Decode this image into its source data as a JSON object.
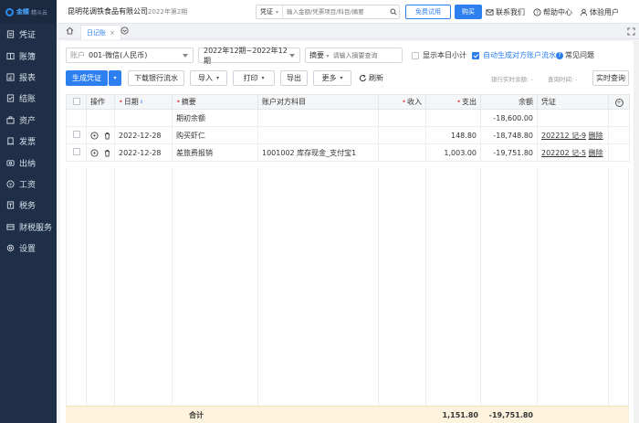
{
  "app": {
    "logo_brand": "金蝶",
    "logo_sub": "精斗云",
    "company": "昆明花调铁食品有限公司",
    "period": "2022年第2期"
  },
  "sidebar": {
    "items": [
      {
        "label": "凭证",
        "icon": "voucher-icon"
      },
      {
        "label": "账簿",
        "icon": "ledger-icon"
      },
      {
        "label": "报表",
        "icon": "report-icon"
      },
      {
        "label": "结账",
        "icon": "closing-icon"
      },
      {
        "label": "资产",
        "icon": "asset-icon"
      },
      {
        "label": "发票",
        "icon": "invoice-icon"
      },
      {
        "label": "出纳",
        "icon": "cashier-icon"
      },
      {
        "label": "工资",
        "icon": "salary-icon"
      },
      {
        "label": "税务",
        "icon": "tax-icon"
      },
      {
        "label": "财税服务",
        "icon": "service-icon"
      },
      {
        "label": "设置",
        "icon": "settings-icon"
      }
    ]
  },
  "topbar": {
    "search_type": "凭证",
    "search_placeholder": "输入金额/凭票项目/科目/摘要",
    "free_trial": "免费试用",
    "buy": "购买",
    "contact": "联系我们",
    "help": "帮助中心",
    "user": "体验用户"
  },
  "tabs": {
    "active": "日记账"
  },
  "filters": {
    "account_label": "账户",
    "account_value": "001-微信(人民币)",
    "period_value": "2022年12期~2022年12期",
    "summary_label": "摘要",
    "summary_placeholder": "请输入摘要查询",
    "show_subtotal": "显示本日小计",
    "auto_generate": "自动生成对方账户流水",
    "faq": "常见问题"
  },
  "toolbar": {
    "generate_voucher": "生成凭证",
    "download_bank": "下载银行流水",
    "import": "导入",
    "print": "打印",
    "export": "导出",
    "more": "更多",
    "refresh": "刷新",
    "bank_balance_label": "银行实时余额:",
    "bank_balance_value": "-",
    "query_time_label": "查询时间:",
    "query_time_value": "-",
    "realtime_query": "实时查询"
  },
  "table": {
    "headers": {
      "op": "操作",
      "date": "日期",
      "summary": "摘要",
      "counter_account": "账户对方科目",
      "income": "收入",
      "expense": "支出",
      "balance": "余额",
      "voucher": "凭证"
    },
    "rows": [
      {
        "date": "",
        "summary": "期初余额",
        "counter": "",
        "income": "",
        "expense": "",
        "balance": "-18,600.00",
        "voucher": "",
        "delete": ""
      },
      {
        "date": "2022-12-28",
        "summary": "购买虾仁",
        "counter": "",
        "income": "",
        "expense": "148.80",
        "balance": "-18,748.80",
        "voucher": "202212 记-9",
        "delete": "删除"
      },
      {
        "date": "2022-12-28",
        "summary": "差旅费报销",
        "counter": "1001002 库存现金_支付宝1",
        "income": "",
        "expense": "1,003.00",
        "balance": "-19,751.80",
        "voucher": "202202 记-5",
        "delete": "删除"
      }
    ],
    "total_label": "合计",
    "total_expense": "1,151.80",
    "total_balance": "-19,751.80"
  },
  "colors": {
    "sidebar_bg": "#1e2f47",
    "accent": "#2d7ff0",
    "total_row": "#fdf3dd"
  }
}
